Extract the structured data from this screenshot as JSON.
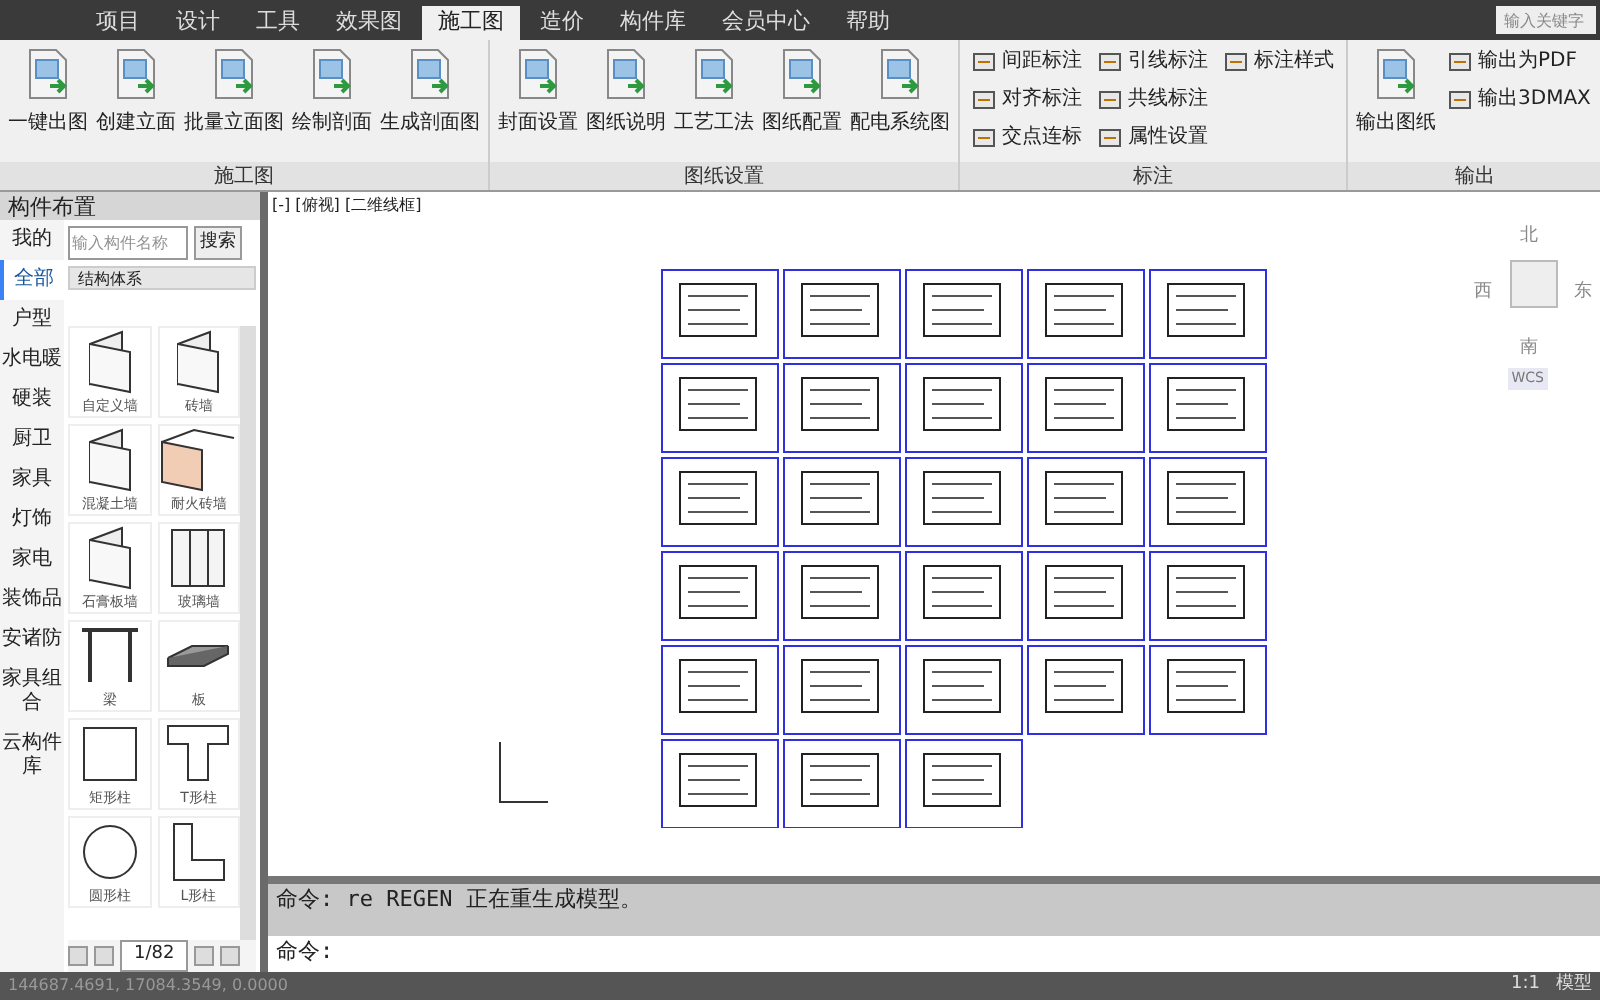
{
  "menu_tabs": [
    {
      "label": "项目",
      "selected": false
    },
    {
      "label": "设计",
      "selected": false
    },
    {
      "label": "工具",
      "selected": false
    },
    {
      "label": "效果图",
      "selected": false
    },
    {
      "label": "施工图",
      "selected": true
    },
    {
      "label": "造价",
      "selected": false
    },
    {
      "label": "构件库",
      "selected": false
    },
    {
      "label": "会员中心",
      "selected": false
    },
    {
      "label": "帮助",
      "selected": false
    }
  ],
  "search": {
    "placeholder": "输入关键字"
  },
  "ribbon": [
    {
      "title": "施工图",
      "items": [
        {
          "kind": "large",
          "label": "一键出图"
        },
        {
          "kind": "large",
          "label": "创建立面"
        },
        {
          "kind": "large",
          "label": "批量立面图"
        },
        {
          "kind": "large",
          "label": "绘制剖面"
        },
        {
          "kind": "large",
          "label": "生成剖面图"
        }
      ]
    },
    {
      "title": "图纸设置",
      "items": [
        {
          "kind": "large",
          "label": "封面设置"
        },
        {
          "kind": "large",
          "label": "图纸说明"
        },
        {
          "kind": "large",
          "label": "工艺工法"
        },
        {
          "kind": "large",
          "label": "图纸配置"
        },
        {
          "kind": "large",
          "label": "配电系统图"
        }
      ]
    },
    {
      "title": "标注",
      "items": [
        {
          "kind": "small",
          "label": "间距标注"
        },
        {
          "kind": "small",
          "label": "对齐标注"
        },
        {
          "kind": "small",
          "label": "交点连标"
        },
        {
          "kind": "small",
          "label": "引线标注"
        },
        {
          "kind": "small",
          "label": "共线标注"
        },
        {
          "kind": "small",
          "label": "属性设置"
        },
        {
          "kind": "small",
          "label": "标注样式"
        }
      ]
    },
    {
      "title": "输出",
      "items": [
        {
          "kind": "large",
          "label": "输出图纸"
        },
        {
          "kind": "small",
          "label": "输出为PDF"
        },
        {
          "kind": "small",
          "label": "输出3DMAX"
        }
      ]
    }
  ],
  "panel": {
    "title": "构件布置",
    "categories": [
      {
        "label": "我的",
        "selected": false
      },
      {
        "label": "全部",
        "selected": true
      },
      {
        "label": "户型",
        "selected": false
      },
      {
        "label": "水电暖",
        "selected": false
      },
      {
        "label": "硬装",
        "selected": false
      },
      {
        "label": "厨卫",
        "selected": false
      },
      {
        "label": "家具",
        "selected": false
      },
      {
        "label": "灯饰",
        "selected": false
      },
      {
        "label": "家电",
        "selected": false
      },
      {
        "label": "装饰品",
        "selected": false
      },
      {
        "label": "安诸防",
        "selected": false
      },
      {
        "label": "家具组合",
        "selected": false
      },
      {
        "label": "云构件库",
        "selected": false
      }
    ],
    "search_placeholder": "输入构件名称",
    "search_button": "搜索",
    "dropdown": "结构体系",
    "components": [
      {
        "kind": "wall",
        "label": "自定义墙"
      },
      {
        "kind": "wall",
        "label": "砖墙"
      },
      {
        "kind": "wall",
        "label": "混凝土墙"
      },
      {
        "kind": "brick",
        "label": "耐火砖墙"
      },
      {
        "kind": "wall",
        "label": "石膏板墙"
      },
      {
        "kind": "glass",
        "label": "玻璃墙"
      },
      {
        "kind": "beam",
        "label": "梁"
      },
      {
        "kind": "slab",
        "label": "板"
      },
      {
        "kind": "rect",
        "label": "矩形柱"
      },
      {
        "kind": "tee",
        "label": "T形柱"
      },
      {
        "kind": "round",
        "label": "圆形柱"
      },
      {
        "kind": "ell",
        "label": "L形柱"
      }
    ],
    "page": "1/82"
  },
  "viewport": {
    "label": "[-] [俯视] [二维线框]",
    "north": "北",
    "south": "南",
    "east": "东",
    "west": "西",
    "ucs": "WCS"
  },
  "command": {
    "history": "命令: re REGEN 正在重生成模型。",
    "prompt": "命令:"
  },
  "status_bar": {
    "coordinates": "144687.4691, 17084.3549, 0.0000",
    "scale": "1:1",
    "space": "模型"
  }
}
